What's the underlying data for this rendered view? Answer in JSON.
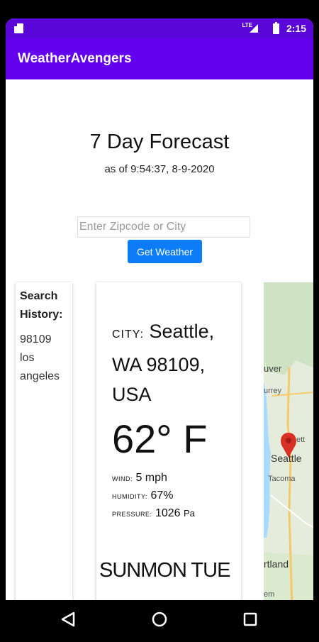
{
  "status_bar": {
    "network": "LTE",
    "time": "2:15"
  },
  "app_bar": {
    "title": "WeatherAvengers"
  },
  "forecast": {
    "heading": "7 Day Forecast",
    "as_of": "as of 9:54:37, 8-9-2020"
  },
  "search": {
    "placeholder": "Enter Zipcode or City",
    "value": "",
    "button_label": "Get Weather"
  },
  "history": {
    "title": "Search History:",
    "items": [
      "98109",
      "los",
      "angeles"
    ]
  },
  "weather": {
    "city_label": "CITY:",
    "city_lines": [
      "Seattle,",
      "WA 98109,",
      "USA"
    ],
    "temperature": "62° F",
    "wind_label": "WIND:",
    "wind_value": "5 mph",
    "humidity_label": "HUMIDITY:",
    "humidity_value": "67%",
    "pressure_label": "PRESSURE:",
    "pressure_value": "1026",
    "pressure_unit": "Pa",
    "days": "SUNMON TUE"
  },
  "map": {
    "labels": [
      "uver",
      "urrey",
      "ett",
      "Seattle",
      "Tacoma",
      "rtland",
      "em"
    ],
    "marker_color": "#d93025"
  },
  "colors": {
    "status_bar": "#5a06d8",
    "app_bar": "#6200ee",
    "button": "#0d7cf7"
  },
  "nav_icons": [
    "back-icon",
    "home-icon",
    "recents-icon"
  ]
}
